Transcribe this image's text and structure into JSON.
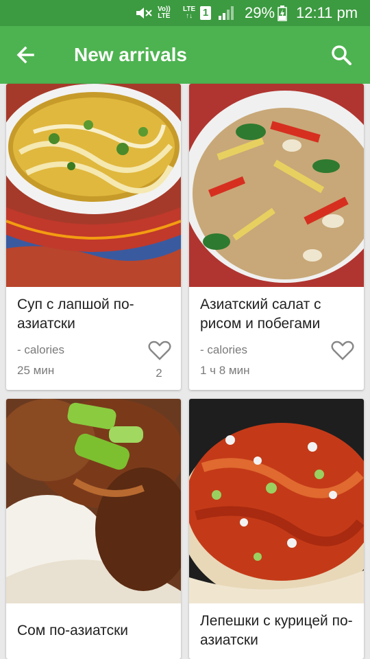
{
  "status_bar": {
    "signal_label_top": "Vo))",
    "signal_label_bottom": "LTE",
    "lte_label": "LTE",
    "sim_slot": "1",
    "battery": "29%",
    "time": "12:11 pm"
  },
  "app_bar": {
    "title": "New arrivals",
    "back_icon": "arrow-back-icon",
    "search_icon": "search-icon"
  },
  "colors": {
    "status_bar": "#3c9a40",
    "app_bar": "#4db350",
    "background": "#e9e9e9",
    "card": "#ffffff"
  },
  "recipes": [
    {
      "name": "Суп с лапшой по-азиатски",
      "calories": "- calories",
      "time": "25 мин",
      "likes": "2",
      "image": "noodle-soup-photo"
    },
    {
      "name": "Азиатский салат с рисом и побегами",
      "calories": "- calories",
      "time": "1 ч 8 мин",
      "likes": "",
      "image": "rice-salad-photo"
    },
    {
      "name": "Сом по-азиатски",
      "calories": "",
      "time": "",
      "likes": "",
      "image": "catfish-photo"
    },
    {
      "name": "Лепешки с курицей по-азиатски",
      "calories": "",
      "time": "",
      "likes": "",
      "image": "chicken-flatbread-photo"
    }
  ]
}
